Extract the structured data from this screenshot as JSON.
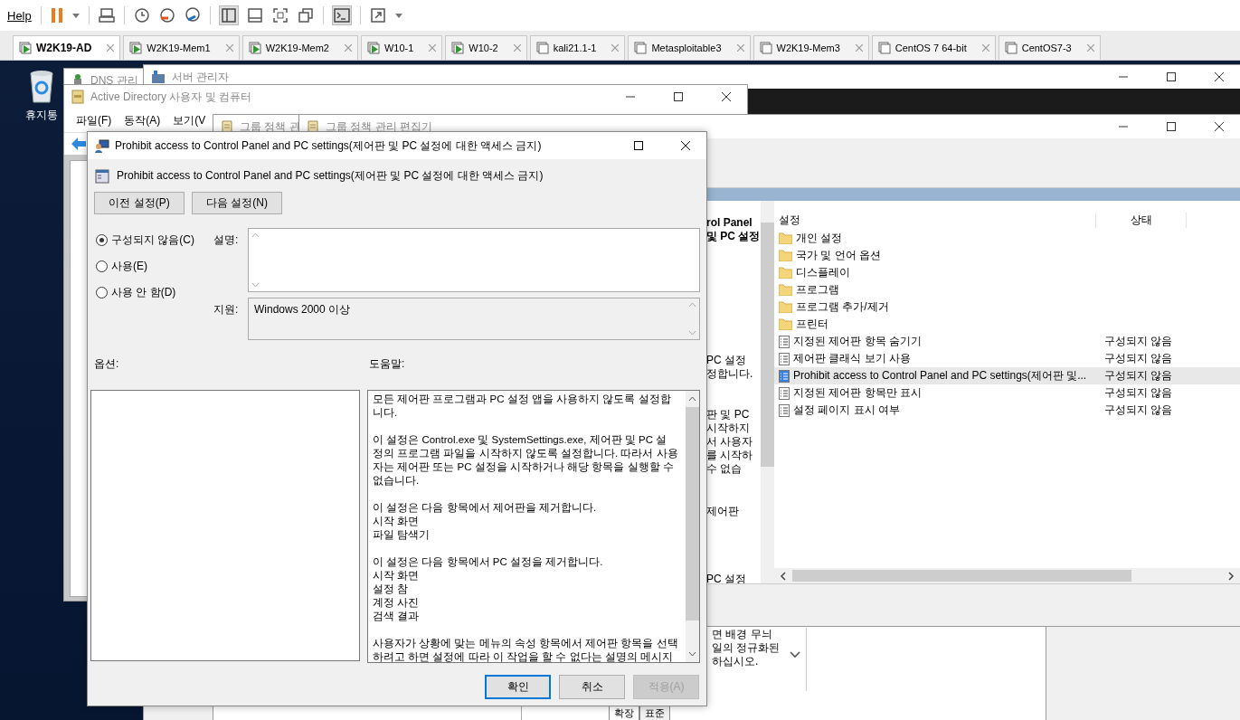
{
  "toolbar": {
    "menu": "Help"
  },
  "vm_tabs": [
    {
      "label": "W2K19-AD",
      "selected": true,
      "running": true
    },
    {
      "label": "W2K19-Mem1",
      "selected": false,
      "running": true
    },
    {
      "label": "W2K19-Mem2",
      "selected": false,
      "running": true
    },
    {
      "label": "W10-1",
      "selected": false,
      "running": true
    },
    {
      "label": "W10-2",
      "selected": false,
      "running": true
    },
    {
      "label": "kali21.1-1",
      "selected": false,
      "running": false
    },
    {
      "label": "Metasploitable3",
      "selected": false,
      "running": false
    },
    {
      "label": "W2K19-Mem3",
      "selected": false,
      "running": false
    },
    {
      "label": "CentOS 7 64-bit",
      "selected": false,
      "running": false
    },
    {
      "label": "CentOS7-3",
      "selected": false,
      "running": false
    }
  ],
  "desktop": {
    "recycle_bin": "휴지통"
  },
  "server_manager": {
    "title": "서버 관리자"
  },
  "dns_window": {
    "title": "DNS 관리"
  },
  "ad_window": {
    "title": "Active Directory 사용자 및 컴퓨터",
    "menu": [
      "파일(F)",
      "동작(A)",
      "보기(V"
    ]
  },
  "gpm_window": {
    "title": "그룹 정책 관",
    "description_fragments": [
      "면 배경 무늬",
      "일의 정규화된",
      "하십시오."
    ],
    "bottom_tabs": [
      {
        "label": "확장",
        "selected": true
      },
      {
        "label": "표준",
        "selected": false
      }
    ]
  },
  "editor": {
    "title": "그룹 정책 관리 편집기",
    "heading_fragments": [
      "rol Panel",
      "및 PC 설정"
    ],
    "text_fragments": [
      [
        "PC 설정",
        "정합니다."
      ],
      [
        "판 및 PC",
        "시작하지",
        "서 사용자",
        "를 시작하",
        "수 없습"
      ],
      [
        "제어판"
      ],
      [
        "PC 설정"
      ]
    ],
    "columns": [
      "설정",
      "상태"
    ],
    "rows": [
      {
        "kind": "folder",
        "name": "개인 설정",
        "selected": false
      },
      {
        "kind": "folder",
        "name": "국가 및 언어 옵션",
        "selected": false
      },
      {
        "kind": "folder",
        "name": "디스플레이",
        "selected": false
      },
      {
        "kind": "folder",
        "name": "프로그램",
        "selected": false
      },
      {
        "kind": "folder",
        "name": "프로그램 추가/제거",
        "selected": false
      },
      {
        "kind": "folder",
        "name": "프린터",
        "selected": false
      },
      {
        "kind": "policy",
        "name": "지정된 제어판 항목 숨기기",
        "state": "구성되지 않음",
        "selected": false
      },
      {
        "kind": "policy",
        "name": "제어판 클래식 보기 사용",
        "state": "구성되지 않음",
        "selected": false
      },
      {
        "kind": "policy",
        "name": "Prohibit access to Control Panel and PC settings(제어판 및...",
        "state": "구성되지 않음",
        "selected": true
      },
      {
        "kind": "policy",
        "name": "지정된 제어판 항목만 표시",
        "state": "구성되지 않음",
        "selected": false
      },
      {
        "kind": "policy",
        "name": "설정 페이지 표시 여부",
        "state": "구성되지 않음",
        "selected": false
      }
    ]
  },
  "dialog": {
    "title": "Prohibit access to Control Panel and PC settings(제어판 및 PC 설정에 대한 액세스 금지)",
    "heading": "Prohibit access to Control Panel and PC settings(제어판 및 PC 설정에 대한 액세스 금지)",
    "nav_buttons": [
      "이전 설정(P)",
      "다음 설정(N)"
    ],
    "radios": [
      {
        "label": "구성되지 않음(C)",
        "selected": true
      },
      {
        "label": "사용(E)",
        "selected": false
      },
      {
        "label": "사용 안 함(D)",
        "selected": false
      }
    ],
    "comment_label": "설명:",
    "support_label": "지원:",
    "support_value": "Windows 2000 이상",
    "options_label": "옵션:",
    "help_label": "도움말:",
    "help": [
      [
        "모든 제어판 프로그램과 PC 설정 앱을 사용하지 않도록 설정합",
        "니다."
      ],
      [
        "이 설정은 Control.exe 및 SystemSettings.exe, 제어판 및 PC 설",
        "정의 프로그램 파일을 시작하지 않도록 설정합니다. 따라서 사용",
        "자는 제어판 또는 PC 설정을 시작하거나 해당 항목을 실행할 수",
        "없습니다."
      ],
      [
        "이 설정은 다음 항목에서 제어판을 제거합니다.",
        "시작 화면",
        "파일 탐색기"
      ],
      [
        "이 설정은 다음 항목에서 PC 설정을 제거합니다.",
        "시작 화면",
        "설정 참",
        "계정 사진",
        "검색 결과"
      ],
      [
        "사용자가 상황에 맞는 메뉴의 속성 항목에서 제어판 항목을 선택",
        "하려고 하면 설정에 따라 이 작업을 할 수 없다는 설명의 메시지"
      ]
    ],
    "buttons": [
      {
        "label": "확인",
        "kind": "default",
        "disabled": false
      },
      {
        "label": "취소",
        "kind": "normal",
        "disabled": false
      },
      {
        "label": "적용(A)",
        "kind": "normal",
        "disabled": true
      }
    ]
  }
}
